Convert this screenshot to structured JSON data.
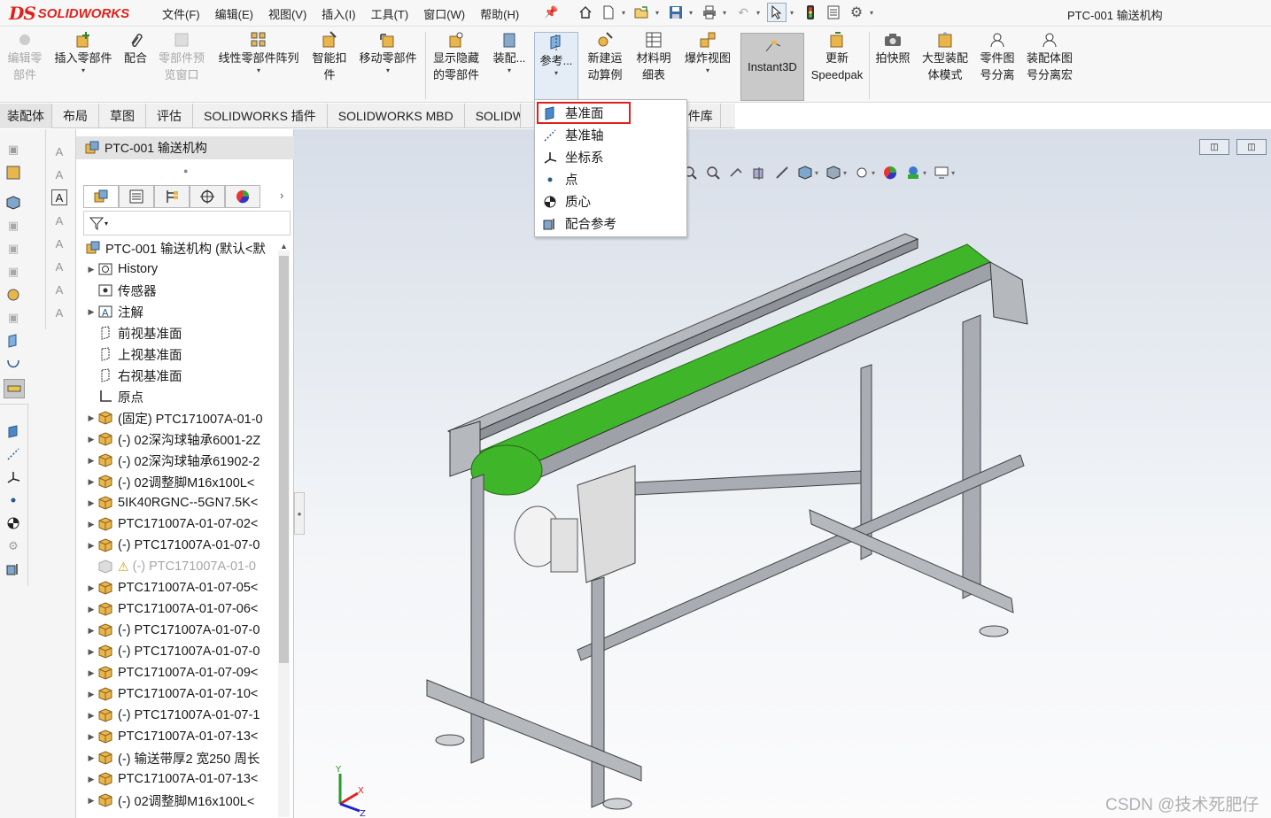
{
  "app": {
    "logo_ds": "DS",
    "logo_text": "SOLIDWORKS",
    "document_title": "PTC-001 输送机构",
    "menus": [
      "文件(F)",
      "编辑(E)",
      "视图(V)",
      "插入(I)",
      "工具(T)",
      "窗口(W)",
      "帮助(H)"
    ],
    "quick_access_icons": [
      "home-icon",
      "new-document-icon",
      "open-icon",
      "save-icon",
      "print-icon",
      "undo-icon",
      "select-cursor-icon",
      "traffic-light-icon",
      "file-properties-icon",
      "options-gear-icon"
    ]
  },
  "command_manager": {
    "edit_component": "编辑零\n部件",
    "insert_components": "插入零部件",
    "mate": "配合",
    "component_preview": "零部件预\n览窗口",
    "linear_pattern": "线性零部件阵列",
    "smart_fasteners": "智能扣\n件",
    "move_component": "移动零部件",
    "show_hidden": "显示隐藏\n的零部件",
    "assembly_features": "装配...",
    "reference_geometry": "参考...",
    "new_motion_study": "新建运\n动算例",
    "bill_of_materials": "材料明\n细表",
    "exploded_view": "爆炸视图",
    "instant3d": "Instant3D",
    "update_speedpak": "更新\nSpeedpak",
    "snapshot": "拍快照",
    "large_assembly": "大型装配\n体模式",
    "part_number_separate": "零件图\n号分离",
    "assembly_number_separate": "装配体图\n号分离宏"
  },
  "tabs": [
    "装配体",
    "布局",
    "草图",
    "评估",
    "SOLIDWORKS 插件",
    "SOLIDWORKS MBD",
    "SOLIDW",
    "零件库"
  ],
  "feature_manager": {
    "header_title": "PTC-001 输送机构",
    "root": "PTC-001 输送机构  (默认<默",
    "rows": [
      {
        "label": "History",
        "expand": true,
        "icon": "history-icon"
      },
      {
        "label": "传感器",
        "expand": false,
        "icon": "sensor-icon"
      },
      {
        "label": "注解",
        "expand": true,
        "icon": "annotation-icon"
      },
      {
        "label": "前视基准面",
        "expand": false,
        "icon": "plane-icon"
      },
      {
        "label": "上视基准面",
        "expand": false,
        "icon": "plane-icon"
      },
      {
        "label": "右视基准面",
        "expand": false,
        "icon": "plane-icon"
      },
      {
        "label": "原点",
        "expand": false,
        "icon": "origin-icon"
      },
      {
        "label": "(固定) PTC171007A-01-0",
        "expand": true,
        "icon": "part-icon"
      },
      {
        "label": "(-) 02深沟球轴承6001-2Z",
        "expand": true,
        "icon": "part-icon"
      },
      {
        "label": "(-) 02深沟球轴承61902-2",
        "expand": true,
        "icon": "part-icon"
      },
      {
        "label": "(-) 02调整脚M16x100L<",
        "expand": true,
        "icon": "part-icon"
      },
      {
        "label": "5IK40RGNC--5GN7.5K<",
        "expand": true,
        "icon": "part-icon"
      },
      {
        "label": "PTC171007A-01-07-02<",
        "expand": true,
        "icon": "part-icon"
      },
      {
        "label": "(-) PTC171007A-01-07-0",
        "expand": true,
        "icon": "part-icon"
      },
      {
        "label": "(-) PTC171007A-01-0",
        "expand": false,
        "icon": "part-warning-icon",
        "dim": true
      },
      {
        "label": "PTC171007A-01-07-05<",
        "expand": true,
        "icon": "part-icon"
      },
      {
        "label": "PTC171007A-01-07-06<",
        "expand": true,
        "icon": "part-icon"
      },
      {
        "label": "(-) PTC171007A-01-07-0",
        "expand": true,
        "icon": "part-icon"
      },
      {
        "label": "(-) PTC171007A-01-07-0",
        "expand": true,
        "icon": "part-icon"
      },
      {
        "label": "PTC171007A-01-07-09<",
        "expand": true,
        "icon": "part-icon"
      },
      {
        "label": "PTC171007A-01-07-10<",
        "expand": true,
        "icon": "part-icon"
      },
      {
        "label": "(-) PTC171007A-01-07-1",
        "expand": true,
        "icon": "part-icon"
      },
      {
        "label": "PTC171007A-01-07-13<",
        "expand": true,
        "icon": "part-icon"
      },
      {
        "label": "(-) 输送带厚2 宽250 周长",
        "expand": true,
        "icon": "part-icon"
      },
      {
        "label": "PTC171007A-01-07-13<",
        "expand": true,
        "icon": "part-icon"
      },
      {
        "label": "(-) 02调整脚M16x100L<",
        "expand": true,
        "icon": "part-icon"
      }
    ]
  },
  "reference_dropdown": {
    "items": [
      {
        "label": "基准面",
        "icon": "plane-icon",
        "highlighted": true
      },
      {
        "label": "基准轴",
        "icon": "axis-icon"
      },
      {
        "label": "坐标系",
        "icon": "coordinate-system-icon"
      },
      {
        "label": "点",
        "icon": "point-icon"
      },
      {
        "label": "质心",
        "icon": "center-of-mass-icon"
      },
      {
        "label": "配合参考",
        "icon": "mate-reference-icon"
      }
    ]
  },
  "graphics": {
    "triad_labels": [
      "Y",
      "X",
      "Z"
    ],
    "belt_color": "#3fb52a",
    "frame_color": "#a9acb2"
  },
  "watermark": "CSDN @技术死肥仔"
}
